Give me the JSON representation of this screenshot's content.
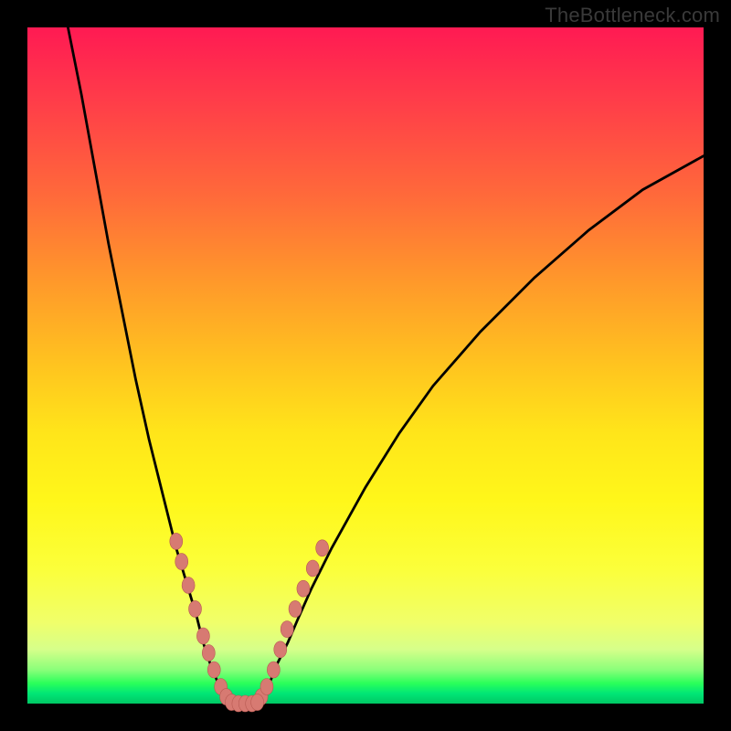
{
  "watermark": "TheBottleneck.com",
  "chart_data": {
    "type": "line",
    "title": "",
    "xlabel": "",
    "ylabel": "",
    "xlim": [
      0,
      100
    ],
    "ylim": [
      0,
      100
    ],
    "grid": false,
    "legend": false,
    "background": "gradient-red-yellow-green",
    "note": "Axes have no tick labels; values estimated from pixel positions on a 0–100 scale.",
    "series": [
      {
        "name": "left-branch",
        "x": [
          6,
          8,
          10,
          12,
          14,
          16,
          18,
          20,
          22,
          23.5,
          25,
          26,
          27,
          28,
          29,
          30
        ],
        "y": [
          100,
          90,
          79,
          68,
          58,
          48,
          39,
          31,
          23,
          18,
          13,
          9,
          6,
          3.5,
          1.5,
          0
        ]
      },
      {
        "name": "right-branch",
        "x": [
          34,
          35,
          36,
          37,
          38.5,
          40,
          42,
          45,
          50,
          55,
          60,
          67,
          75,
          83,
          91,
          100
        ],
        "y": [
          0,
          1.5,
          3.5,
          6,
          9,
          12.5,
          17,
          23,
          32,
          40,
          47,
          55,
          63,
          70,
          76,
          81
        ]
      },
      {
        "name": "bottom-flat",
        "x": [
          30,
          34
        ],
        "y": [
          0,
          0
        ]
      }
    ],
    "markers_left": [
      {
        "x": 22.0,
        "y": 24.0
      },
      {
        "x": 22.8,
        "y": 21.0
      },
      {
        "x": 23.8,
        "y": 17.5
      },
      {
        "x": 24.8,
        "y": 14.0
      },
      {
        "x": 26.0,
        "y": 10.0
      },
      {
        "x": 26.8,
        "y": 7.5
      },
      {
        "x": 27.6,
        "y": 5.0
      },
      {
        "x": 28.6,
        "y": 2.5
      },
      {
        "x": 29.4,
        "y": 1.0
      }
    ],
    "markers_right": [
      {
        "x": 34.6,
        "y": 1.0
      },
      {
        "x": 35.4,
        "y": 2.5
      },
      {
        "x": 36.4,
        "y": 5.0
      },
      {
        "x": 37.4,
        "y": 8.0
      },
      {
        "x": 38.4,
        "y": 11.0
      },
      {
        "x": 39.6,
        "y": 14.0
      },
      {
        "x": 40.8,
        "y": 17.0
      },
      {
        "x": 42.2,
        "y": 20.0
      },
      {
        "x": 43.6,
        "y": 23.0
      }
    ],
    "markers_bottom": [
      {
        "x": 30.2,
        "y": 0.2
      },
      {
        "x": 31.2,
        "y": 0.0
      },
      {
        "x": 32.2,
        "y": 0.0
      },
      {
        "x": 33.2,
        "y": 0.0
      },
      {
        "x": 34.0,
        "y": 0.2
      }
    ]
  }
}
